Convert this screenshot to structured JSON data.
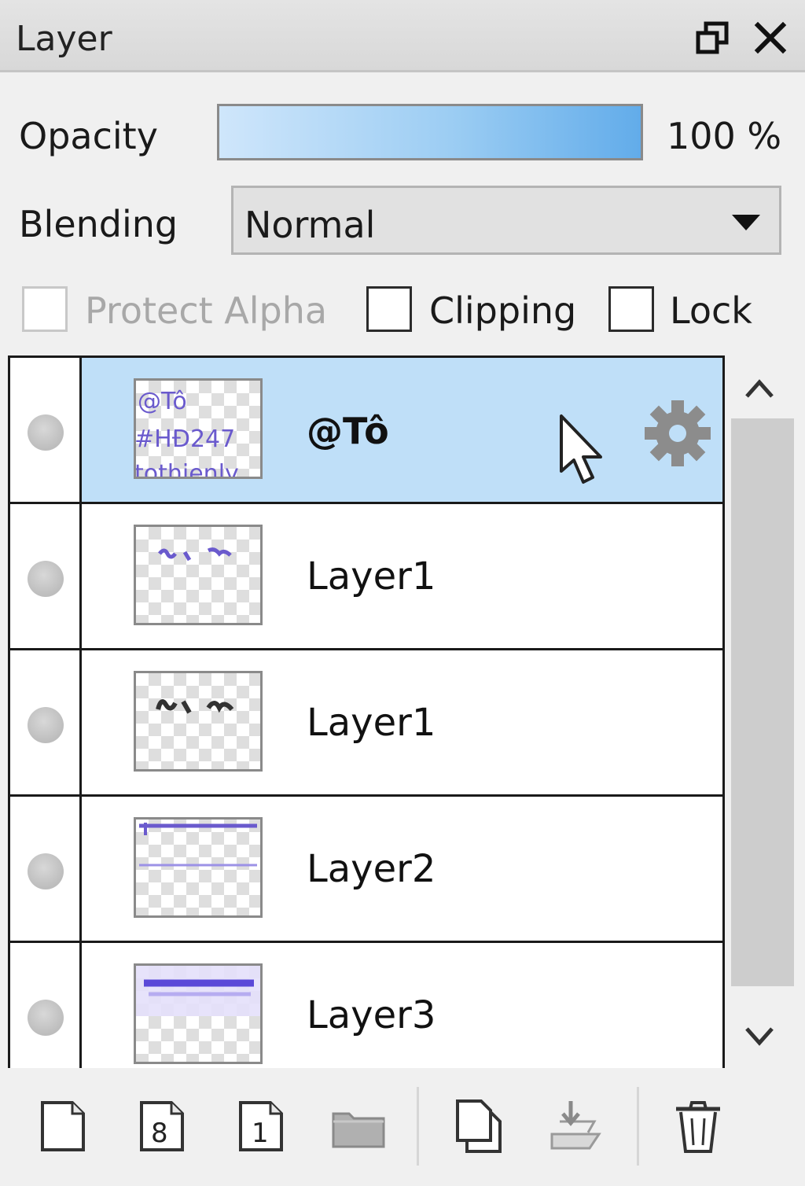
{
  "window": {
    "title": "Layer",
    "restore_icon": "restore-window-icon",
    "close_icon": "close-icon"
  },
  "opacity": {
    "label": "Opacity",
    "value_text": "100 %",
    "value": 100
  },
  "blending": {
    "label": "Blending",
    "selected": "Normal"
  },
  "options": {
    "protect_alpha": {
      "label": "Protect Alpha",
      "checked": false,
      "disabled": true
    },
    "clipping": {
      "label": "Clipping",
      "checked": false,
      "disabled": false
    },
    "lock": {
      "label": "Lock",
      "checked": false,
      "disabled": false
    }
  },
  "layers": [
    {
      "name": "@Tô",
      "selected": true,
      "thumb_text": [
        "@Tô",
        "#HĐ247",
        "tothienly"
      ]
    },
    {
      "name": "Layer1",
      "selected": false
    },
    {
      "name": "Layer1",
      "selected": false
    },
    {
      "name": "Layer2",
      "selected": false
    },
    {
      "name": "Layer3",
      "selected": false
    }
  ],
  "toolbar": {
    "buttons": [
      "new-layer-icon",
      "new-8bit-layer-icon",
      "new-1bit-layer-icon",
      "new-folder-icon",
      "duplicate-layer-icon",
      "merge-down-icon",
      "delete-layer-icon"
    ],
    "badge_8": "8",
    "badge_1": "1"
  }
}
